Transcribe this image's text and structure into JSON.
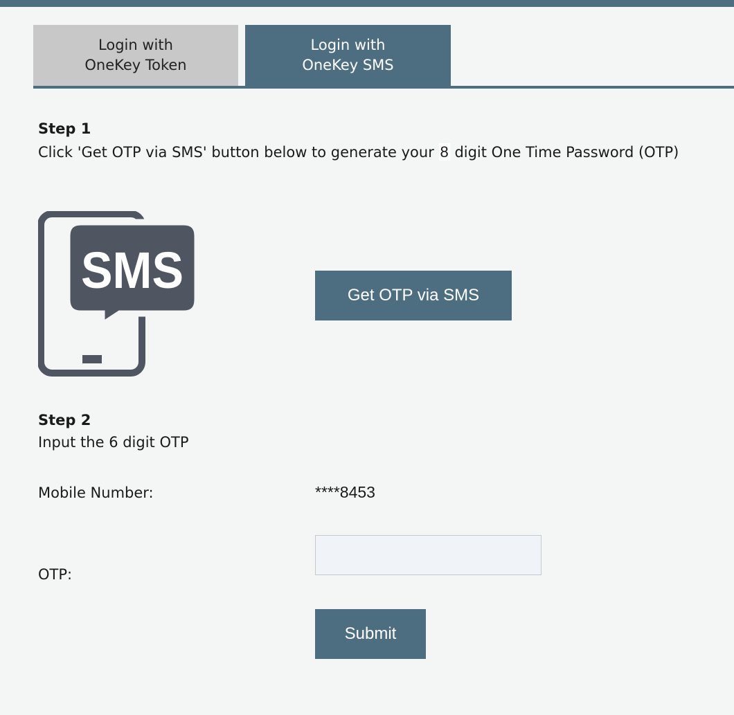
{
  "tabs": {
    "token_label_line1": "Login with",
    "token_label_line2": "OneKey Token",
    "sms_label_line1": "Login with",
    "sms_label_line2": "OneKey SMS",
    "active": "sms"
  },
  "step1": {
    "title": "Step 1",
    "text_before": "Click 'Get OTP via SMS' button below to generate your ",
    "digits": "8",
    "text_after": " digit One Time Password (OTP)",
    "illustration_icon": "sms-phone-icon",
    "illustration_text": "SMS",
    "button_label": "Get OTP via SMS"
  },
  "step2": {
    "title": "Step 2",
    "text": "Input the 6 digit OTP",
    "mobile_label": "Mobile Number:",
    "mobile_value": "****8453",
    "otp_label": "OTP:",
    "otp_value": "",
    "submit_label": "Submit"
  },
  "colors": {
    "accent": "#4d6e80",
    "inactive_tab": "#c8c8c8",
    "background": "#f4f5f5",
    "icon": "#4f5561"
  }
}
